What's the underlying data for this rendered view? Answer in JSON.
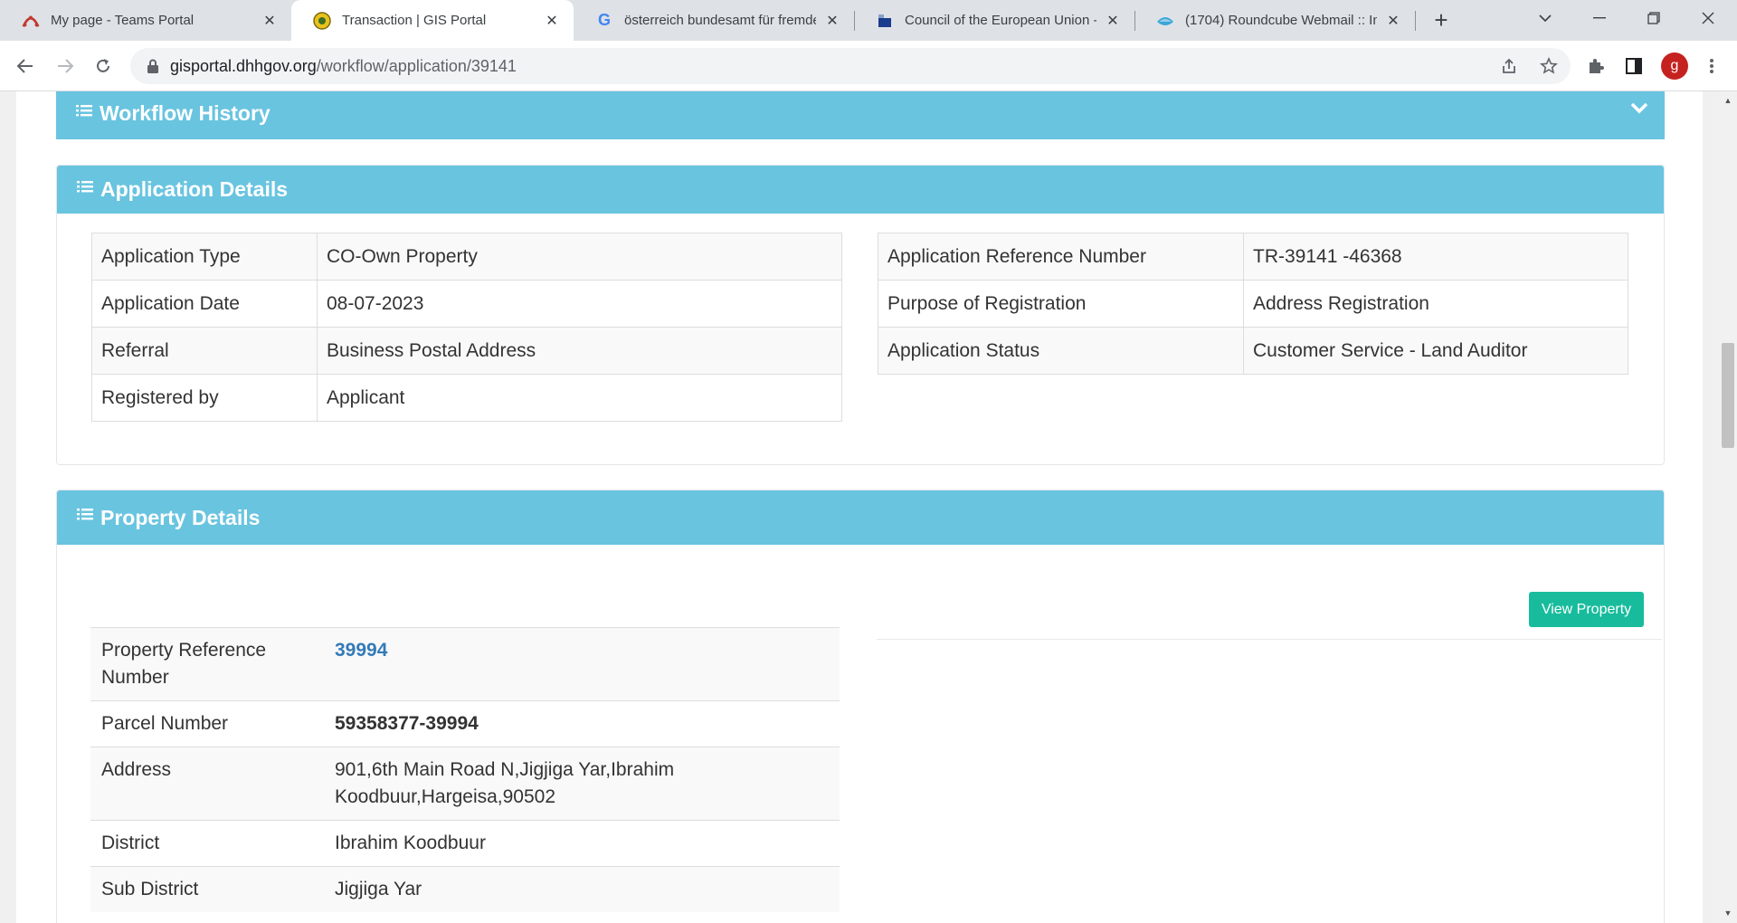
{
  "browser": {
    "tabs": [
      {
        "title": "My page - Teams Portal",
        "icon": "teams-portal-icon"
      },
      {
        "title": "Transaction | GIS Portal",
        "icon": "gis-portal-icon",
        "active": true
      },
      {
        "title": "österreich bundesamt für fremden",
        "icon": "google-icon"
      },
      {
        "title": "Council of the European Union - P",
        "icon": "eu-council-icon"
      },
      {
        "title": "(1704) Roundcube Webmail :: Inbo",
        "icon": "roundcube-icon"
      }
    ],
    "url_host": "gisportal.dhhgov.org",
    "url_path": "/workflow/application/39141",
    "profile_initial": "g"
  },
  "workflow_history": {
    "title": "Workflow History"
  },
  "application_details": {
    "title": "Application Details",
    "left": [
      {
        "label": "Application Type",
        "value": "CO-Own Property"
      },
      {
        "label": "Application Date",
        "value": "08-07-2023"
      },
      {
        "label": "Referral",
        "value": "Business Postal Address"
      },
      {
        "label": "Registered by",
        "value": "Applicant"
      }
    ],
    "right": [
      {
        "label": "Application Reference Number",
        "value": "TR-39141 -46368"
      },
      {
        "label": "Purpose of Registration",
        "value": "Address Registration"
      },
      {
        "label": "Application Status",
        "value": "Customer Service - Land Auditor"
      }
    ]
  },
  "property_details": {
    "title": "Property Details",
    "view_button": "View Property",
    "rows": [
      {
        "label": "Property Reference Number",
        "value": "39994"
      },
      {
        "label": "Parcel Number",
        "value": "59358377-39994"
      },
      {
        "label": "Address",
        "value": "901,6th Main Road N,Jigjiga Yar,Ibrahim Koodbuur,Hargeisa,90502"
      },
      {
        "label": "District",
        "value": "Ibrahim Koodbuur"
      },
      {
        "label": "Sub District",
        "value": "Jigjiga Yar"
      }
    ]
  }
}
